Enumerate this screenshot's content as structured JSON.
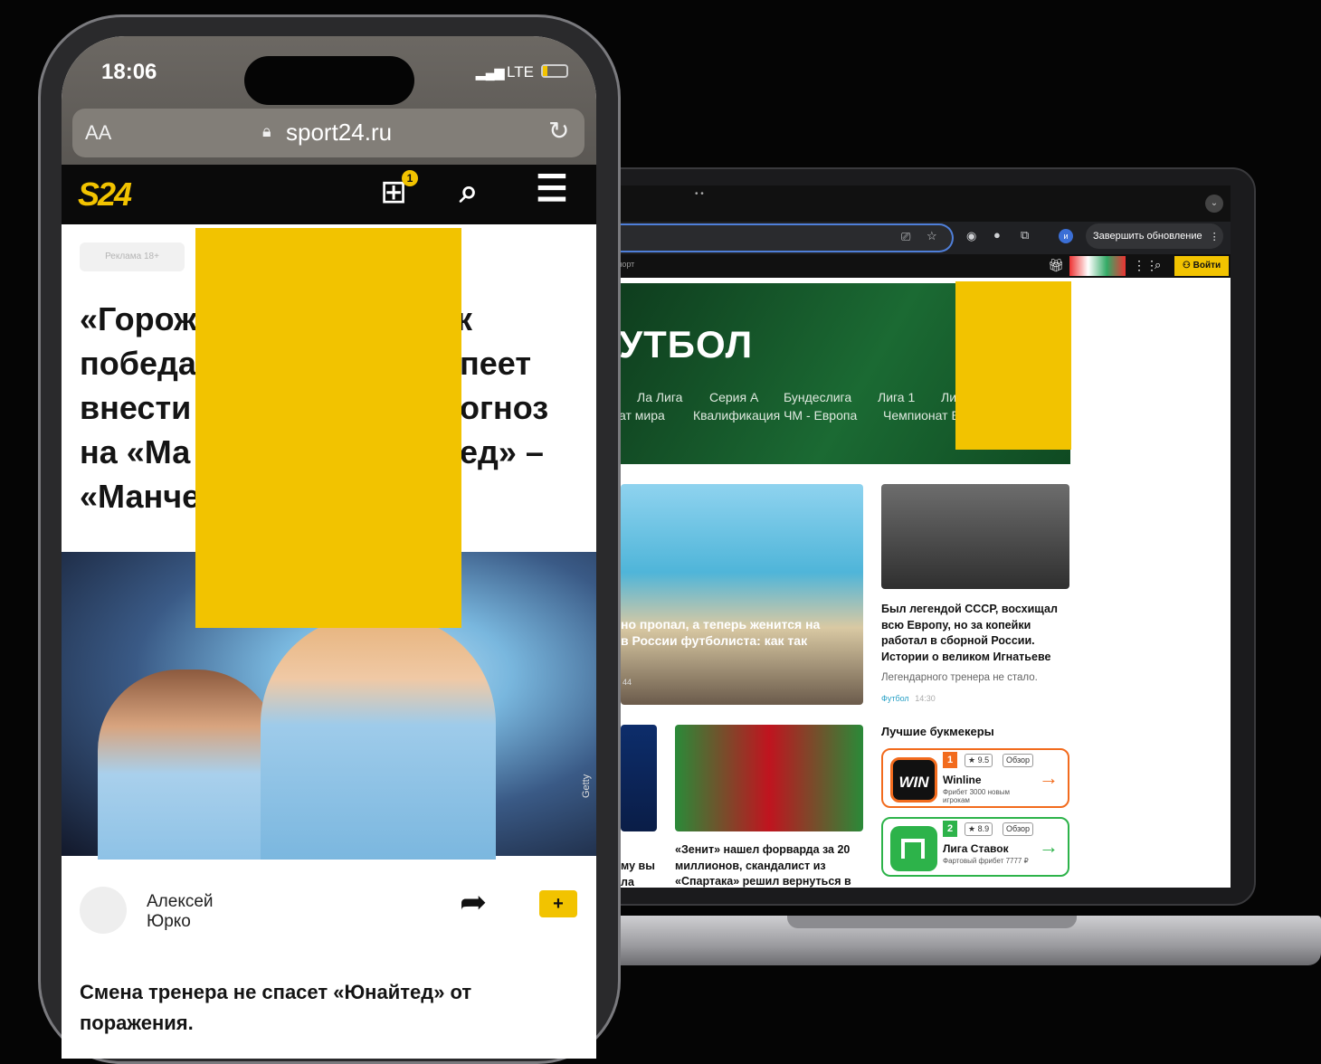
{
  "colors": {
    "accent_yellow": "#f2c300",
    "winline_orange": "#f26b1d",
    "liga_green": "#2db34a",
    "link_blue": "#4f7fd9"
  },
  "laptop": {
    "browser": {
      "update_button": "Завершить обновление",
      "update_more_icon": "more-vertical-icon"
    },
    "site_header": {
      "crumb": "Спорт",
      "login_label": "Войти"
    },
    "hero": {
      "title": "УТБОЛ",
      "links_row1": [
        "Ла Лига",
        "Серия А",
        "Бундеслига",
        "Лига 1",
        "Ли"
      ],
      "links_row2": [
        "ат мира",
        "Квалификация ЧМ - Европа",
        "Чемпионат Е"
      ]
    },
    "news": {
      "big_story": {
        "title": "но пропал, а теперь женится на\nв России футболиста: как так",
        "time": "44"
      },
      "ignatiev": {
        "title": "Был легендой СССР, восхищал всю Европу, но за копейки работал в сборной России. Истории о великом Игнатьеве",
        "lead": "Легендарного тренера не стало.",
        "tag": "Футбол",
        "time": "14:30"
      },
      "zenit": {
        "title": "«Зенит» нашел форварда за 20 миллионов, скандалист из «Спартака» решил вернуться в"
      },
      "cut_story": {
        "title": "му вы\nла"
      }
    },
    "bookmakers": {
      "heading": "Лучшие букмекеры",
      "items": [
        {
          "rank": "1",
          "rating": "★ 9.5",
          "review": "Обзор",
          "name": "Winline",
          "note": "Фрибет 3000 новым игрокам",
          "logo": "WIN"
        },
        {
          "rank": "2",
          "rating": "★ 8.9",
          "review": "Обзор",
          "name": "Лига Ставок",
          "note": "Фартовый фрибет 7777 ₽"
        }
      ]
    }
  },
  "phone": {
    "status": {
      "time": "18:06",
      "network": "LTE"
    },
    "url_bar": {
      "text_size": "AA",
      "domain": "sport24.ru"
    },
    "header": {
      "logo": "S24",
      "gift_badge": "1"
    },
    "ad_badge": "Реклама 18+",
    "article": {
      "title_lines": [
        "«Горож",
        "победа",
        "внести",
        "на «Ма",
        "«Манче"
      ],
      "title_right": [
        "к",
        "пеет",
        "огноз",
        "ед» –",
        ""
      ],
      "photo_credit": "Getty",
      "author": {
        "first": "Алексей",
        "last": "Юрко"
      },
      "comment_button": "+",
      "lead": "Смена тренера не спасет «Юнайтед» от поражения."
    }
  }
}
